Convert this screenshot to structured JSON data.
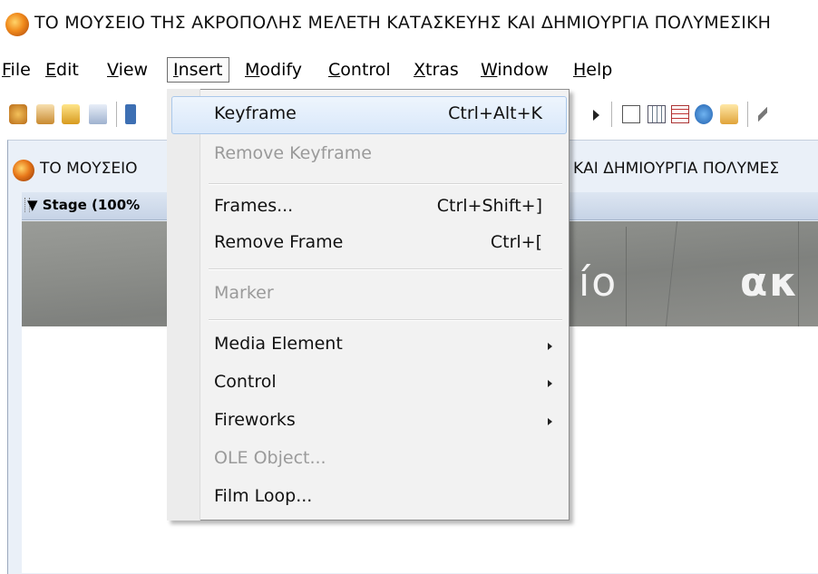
{
  "window": {
    "title": "ΤΟ ΜΟΥΣΕΙΟ ΤΗΣ ΑΚΡΟΠΟΛΗΣ ΜΕΛΕΤΗ ΚΑΤΑΣΚΕΥΗΣ ΚΑΙ ΔΗΜΙΟΥΡΓΙΑ ΠΟΛΥΜΕΣΙΚΗ"
  },
  "menubar": {
    "items": [
      {
        "label": "File",
        "underline": "F"
      },
      {
        "label": "Edit",
        "underline": "E"
      },
      {
        "label": "View",
        "underline": "V"
      },
      {
        "label": "Insert",
        "underline": "I",
        "active": true
      },
      {
        "label": "Modify",
        "underline": "M"
      },
      {
        "label": "Control",
        "underline": "C"
      },
      {
        "label": "Xtras",
        "underline": "X"
      },
      {
        "label": "Window",
        "underline": "W"
      },
      {
        "label": "Help",
        "underline": "H"
      }
    ]
  },
  "movie_window": {
    "title_left": "ΤΟ ΜΟΥΣΕΙΟ",
    "title_right": "ΚΑΙ ΔΗΜΙΟΥΡΓΙΑ ΠΟΛΥΜΕΣ",
    "stage_label": "▼ Stage (100%",
    "stage_text_left": "ío",
    "stage_text_right": "ακ"
  },
  "insert_menu": {
    "items": [
      {
        "label": "Keyframe",
        "shortcut": "Ctrl+Alt+K",
        "enabled": true,
        "highlighted": true
      },
      {
        "label": "Remove Keyframe",
        "shortcut": "",
        "enabled": false
      },
      {
        "label": "Frames...",
        "shortcut": "Ctrl+Shift+]",
        "enabled": true
      },
      {
        "label": "Remove Frame",
        "shortcut": "Ctrl+[",
        "enabled": true
      },
      {
        "label": "Marker",
        "shortcut": "",
        "enabled": false
      },
      {
        "label": "Media Element",
        "shortcut": "",
        "enabled": true,
        "submenu": true
      },
      {
        "label": "Control",
        "shortcut": "",
        "enabled": true,
        "submenu": true
      },
      {
        "label": "Fireworks",
        "shortcut": "",
        "enabled": true,
        "submenu": true
      },
      {
        "label": "OLE Object...",
        "shortcut": "",
        "enabled": false
      },
      {
        "label": "Film Loop...",
        "shortcut": "",
        "enabled": true
      }
    ]
  },
  "colors": {
    "highlight": "#d9e8fa",
    "disabled_text": "#9a9a9a",
    "stage_bar": "#c6d3e6"
  }
}
